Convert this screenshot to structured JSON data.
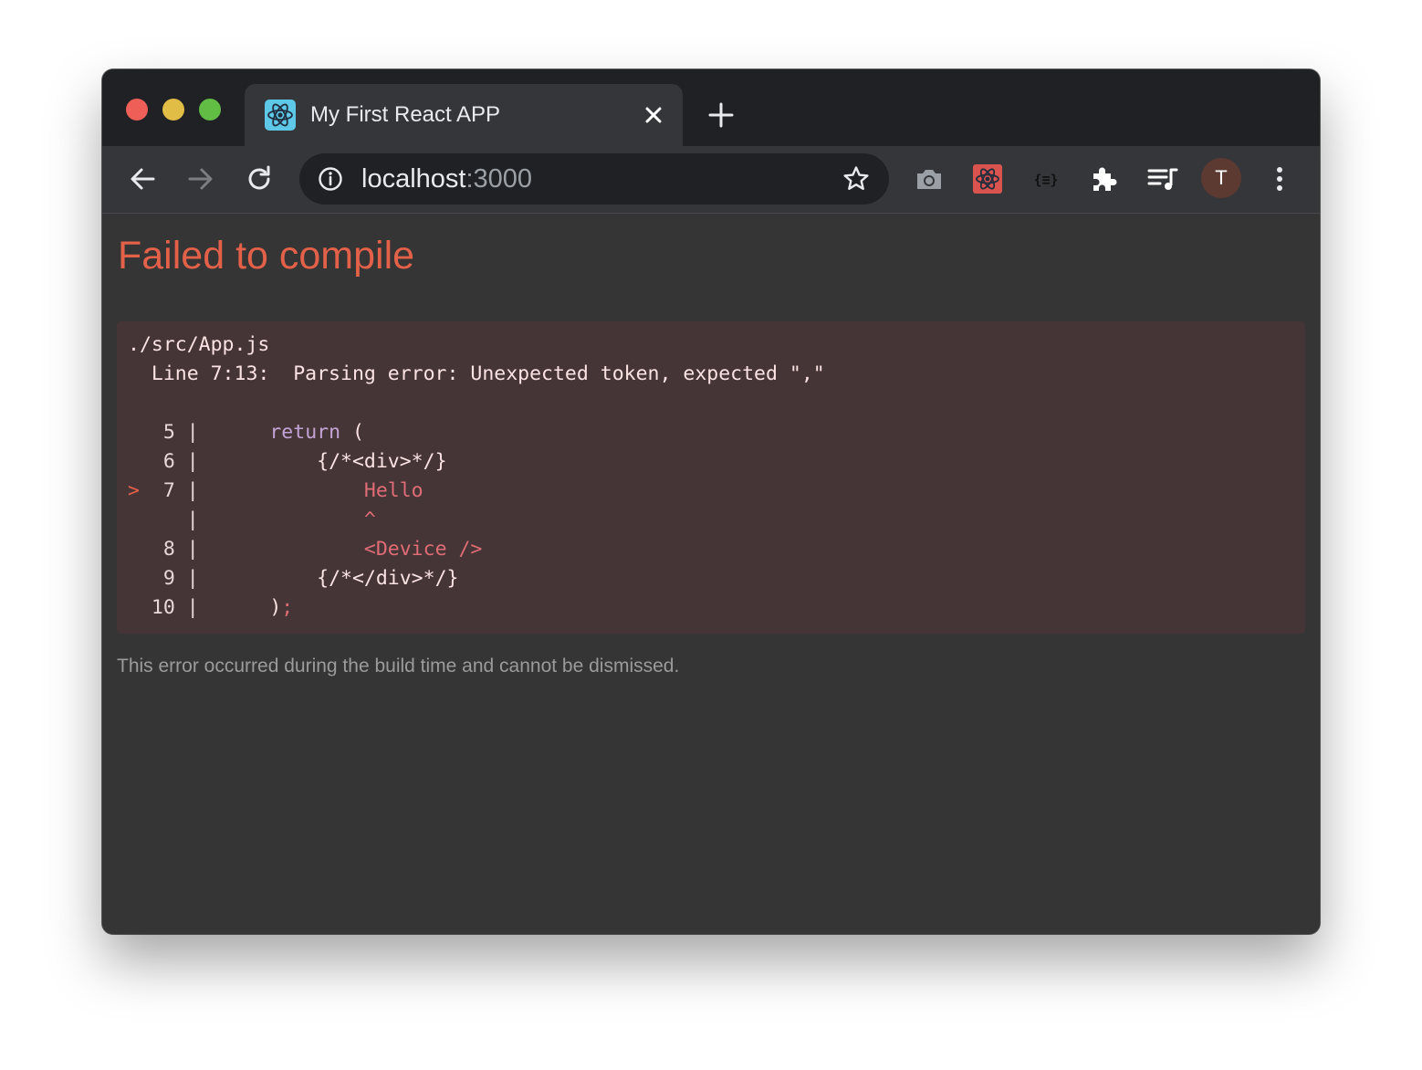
{
  "tab": {
    "title": "My First React APP",
    "favicon": "react-icon"
  },
  "toolbar": {
    "url_host": "localhost",
    "url_port": ":3000",
    "profile_initial": "T",
    "extensions": [
      "camera-icon",
      "react-devtools-icon",
      "json-formatter-icon",
      "puzzle-icon",
      "media-controls-icon"
    ]
  },
  "error": {
    "title": "Failed to compile",
    "file": "./src/App.js",
    "message": "  Line 7:13:  Parsing error: Unexpected token, expected \",\"",
    "lines": [
      {
        "marker": "",
        "number": "5",
        "code_plain": "    ",
        "code_kw": "return",
        "code_rest": " ("
      },
      {
        "marker": "",
        "number": "6",
        "code_plain": "        {/*<div>*/}"
      },
      {
        "marker": ">",
        "number": "7",
        "code_hl": "            Hello"
      },
      {
        "marker": "",
        "number": "",
        "code_hl": "            ^"
      },
      {
        "marker": "",
        "number": "8",
        "code_hl": "            <Device />"
      },
      {
        "marker": "",
        "number": "9",
        "code_plain": "        {/*</div>*/}"
      },
      {
        "marker": "",
        "number": "10",
        "code_plain": "    )",
        "code_hl_tail": ";"
      }
    ],
    "footer": "This error occurred during the build time and cannot be dismissed."
  },
  "colors": {
    "error_red": "#e36049",
    "code_bg": "#453536",
    "page_bg": "#353535"
  }
}
